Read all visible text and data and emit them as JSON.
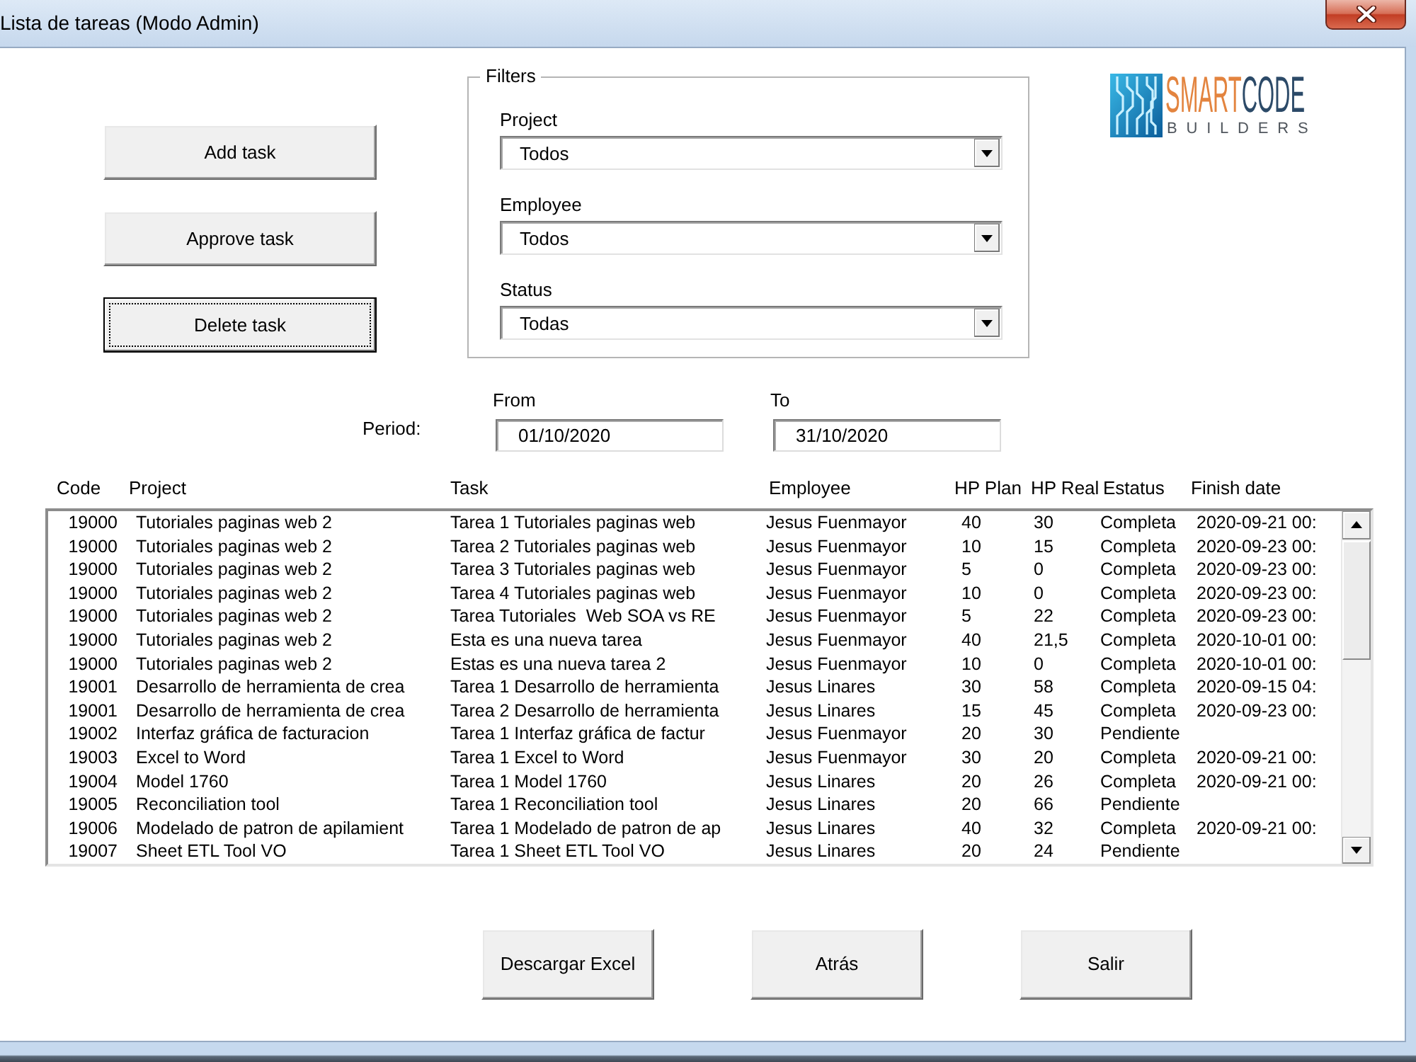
{
  "window": {
    "title": "Lista de tareas (Modo Admin)"
  },
  "actions": [
    {
      "label": "Add task",
      "focused": false
    },
    {
      "label": "Approve task",
      "focused": false
    },
    {
      "label": "Delete task",
      "focused": true
    }
  ],
  "filters": {
    "title": "Filters",
    "fields": [
      {
        "label": "Project",
        "value": "Todos"
      },
      {
        "label": "Employee",
        "value": "Todos"
      },
      {
        "label": "Status",
        "value": "Todas"
      }
    ]
  },
  "logo": {
    "wordmark": [
      "SMART",
      "CODE"
    ],
    "tagline": "BUILDERS"
  },
  "period": {
    "label": "Period:",
    "from": {
      "label": "From",
      "value": "01/10/2020"
    },
    "to": {
      "label": "To",
      "value": "31/10/2020"
    }
  },
  "task_list": {
    "columns": [
      "Code",
      "Project",
      "Task",
      "Employee",
      "HP Plan",
      "HP Real",
      "Estatus",
      "Finish date"
    ],
    "rows": [
      {
        "code": "19000",
        "project": "Tutoriales paginas web 2",
        "task": "Tarea 1 Tutoriales paginas web",
        "employee": "Jesus Fuenmayor",
        "hp_plan": "40",
        "hp_real": "30",
        "status": "Completa",
        "finish_date": "2020-09-21 00:"
      },
      {
        "code": "19000",
        "project": "Tutoriales paginas web 2",
        "task": "Tarea 2 Tutoriales paginas web",
        "employee": "Jesus Fuenmayor",
        "hp_plan": "10",
        "hp_real": "15",
        "status": "Completa",
        "finish_date": "2020-09-23 00:"
      },
      {
        "code": "19000",
        "project": "Tutoriales paginas web 2",
        "task": "Tarea 3 Tutoriales paginas web",
        "employee": "Jesus Fuenmayor",
        "hp_plan": "5",
        "hp_real": "0",
        "status": "Completa",
        "finish_date": "2020-09-23 00:"
      },
      {
        "code": "19000",
        "project": "Tutoriales paginas web 2",
        "task": "Tarea 4 Tutoriales paginas web",
        "employee": "Jesus Fuenmayor",
        "hp_plan": "10",
        "hp_real": "0",
        "status": "Completa",
        "finish_date": "2020-09-23 00:"
      },
      {
        "code": "19000",
        "project": "Tutoriales paginas web 2",
        "task": "Tarea Tutoriales  Web SOA vs RE",
        "employee": "Jesus Fuenmayor",
        "hp_plan": "5",
        "hp_real": "22",
        "status": "Completa",
        "finish_date": "2020-09-23 00:"
      },
      {
        "code": "19000",
        "project": "Tutoriales paginas web 2",
        "task": "Esta es una nueva tarea",
        "employee": "Jesus Fuenmayor",
        "hp_plan": "40",
        "hp_real": "21,5",
        "status": "Completa",
        "finish_date": "2020-10-01 00:"
      },
      {
        "code": "19000",
        "project": "Tutoriales paginas web 2",
        "task": "Estas es una nueva tarea 2",
        "employee": "Jesus Fuenmayor",
        "hp_plan": "10",
        "hp_real": "0",
        "status": "Completa",
        "finish_date": "2020-10-01 00:"
      },
      {
        "code": "19001",
        "project": "Desarrollo de herramienta de crea",
        "task": "Tarea 1 Desarrollo de herramienta",
        "employee": "Jesus Linares",
        "hp_plan": "30",
        "hp_real": "58",
        "status": "Completa",
        "finish_date": "2020-09-15 04:"
      },
      {
        "code": "19001",
        "project": "Desarrollo de herramienta de crea",
        "task": "Tarea 2 Desarrollo de herramienta",
        "employee": "Jesus Linares",
        "hp_plan": "15",
        "hp_real": "45",
        "status": "Completa",
        "finish_date": "2020-09-23 00:"
      },
      {
        "code": "19002",
        "project": "Interfaz gráfica de facturacion",
        "task": "Tarea 1 Interfaz gráfica de factur",
        "employee": "Jesus Fuenmayor",
        "hp_plan": "20",
        "hp_real": "30",
        "status": "Pendiente"
      },
      {
        "code": "19003",
        "project": "Excel to Word",
        "task": "Tarea 1 Excel to Word",
        "employee": "Jesus Fuenmayor",
        "hp_plan": "30",
        "hp_real": "20",
        "status": "Completa",
        "finish_date": "2020-09-21 00:"
      },
      {
        "code": "19004",
        "project": "Model 1760",
        "task": "Tarea 1 Model 1760",
        "employee": "Jesus Linares",
        "hp_plan": "20",
        "hp_real": "26",
        "status": "Completa",
        "finish_date": "2020-09-21 00:"
      },
      {
        "code": "19005",
        "project": "Reconciliation tool",
        "task": "Tarea 1 Reconciliation tool",
        "employee": "Jesus Linares",
        "hp_plan": "20",
        "hp_real": "66",
        "status": "Pendiente"
      },
      {
        "code": "19006",
        "project": "Modelado de patron de apilamient",
        "task": "Tarea 1 Modelado de patron de ap",
        "employee": "Jesus Linares",
        "hp_plan": "40",
        "hp_real": "32",
        "status": "Completa",
        "finish_date": "2020-09-21 00:"
      },
      {
        "code": "19007",
        "project": "Sheet ETL Tool VO",
        "task": "Tarea 1 Sheet ETL Tool VO",
        "employee": "Jesus Linares",
        "hp_plan": "20",
        "hp_real": "24",
        "status": "Pendiente"
      }
    ]
  },
  "footer_buttons": [
    "Descargar Excel",
    "Atrás",
    "Salir"
  ]
}
